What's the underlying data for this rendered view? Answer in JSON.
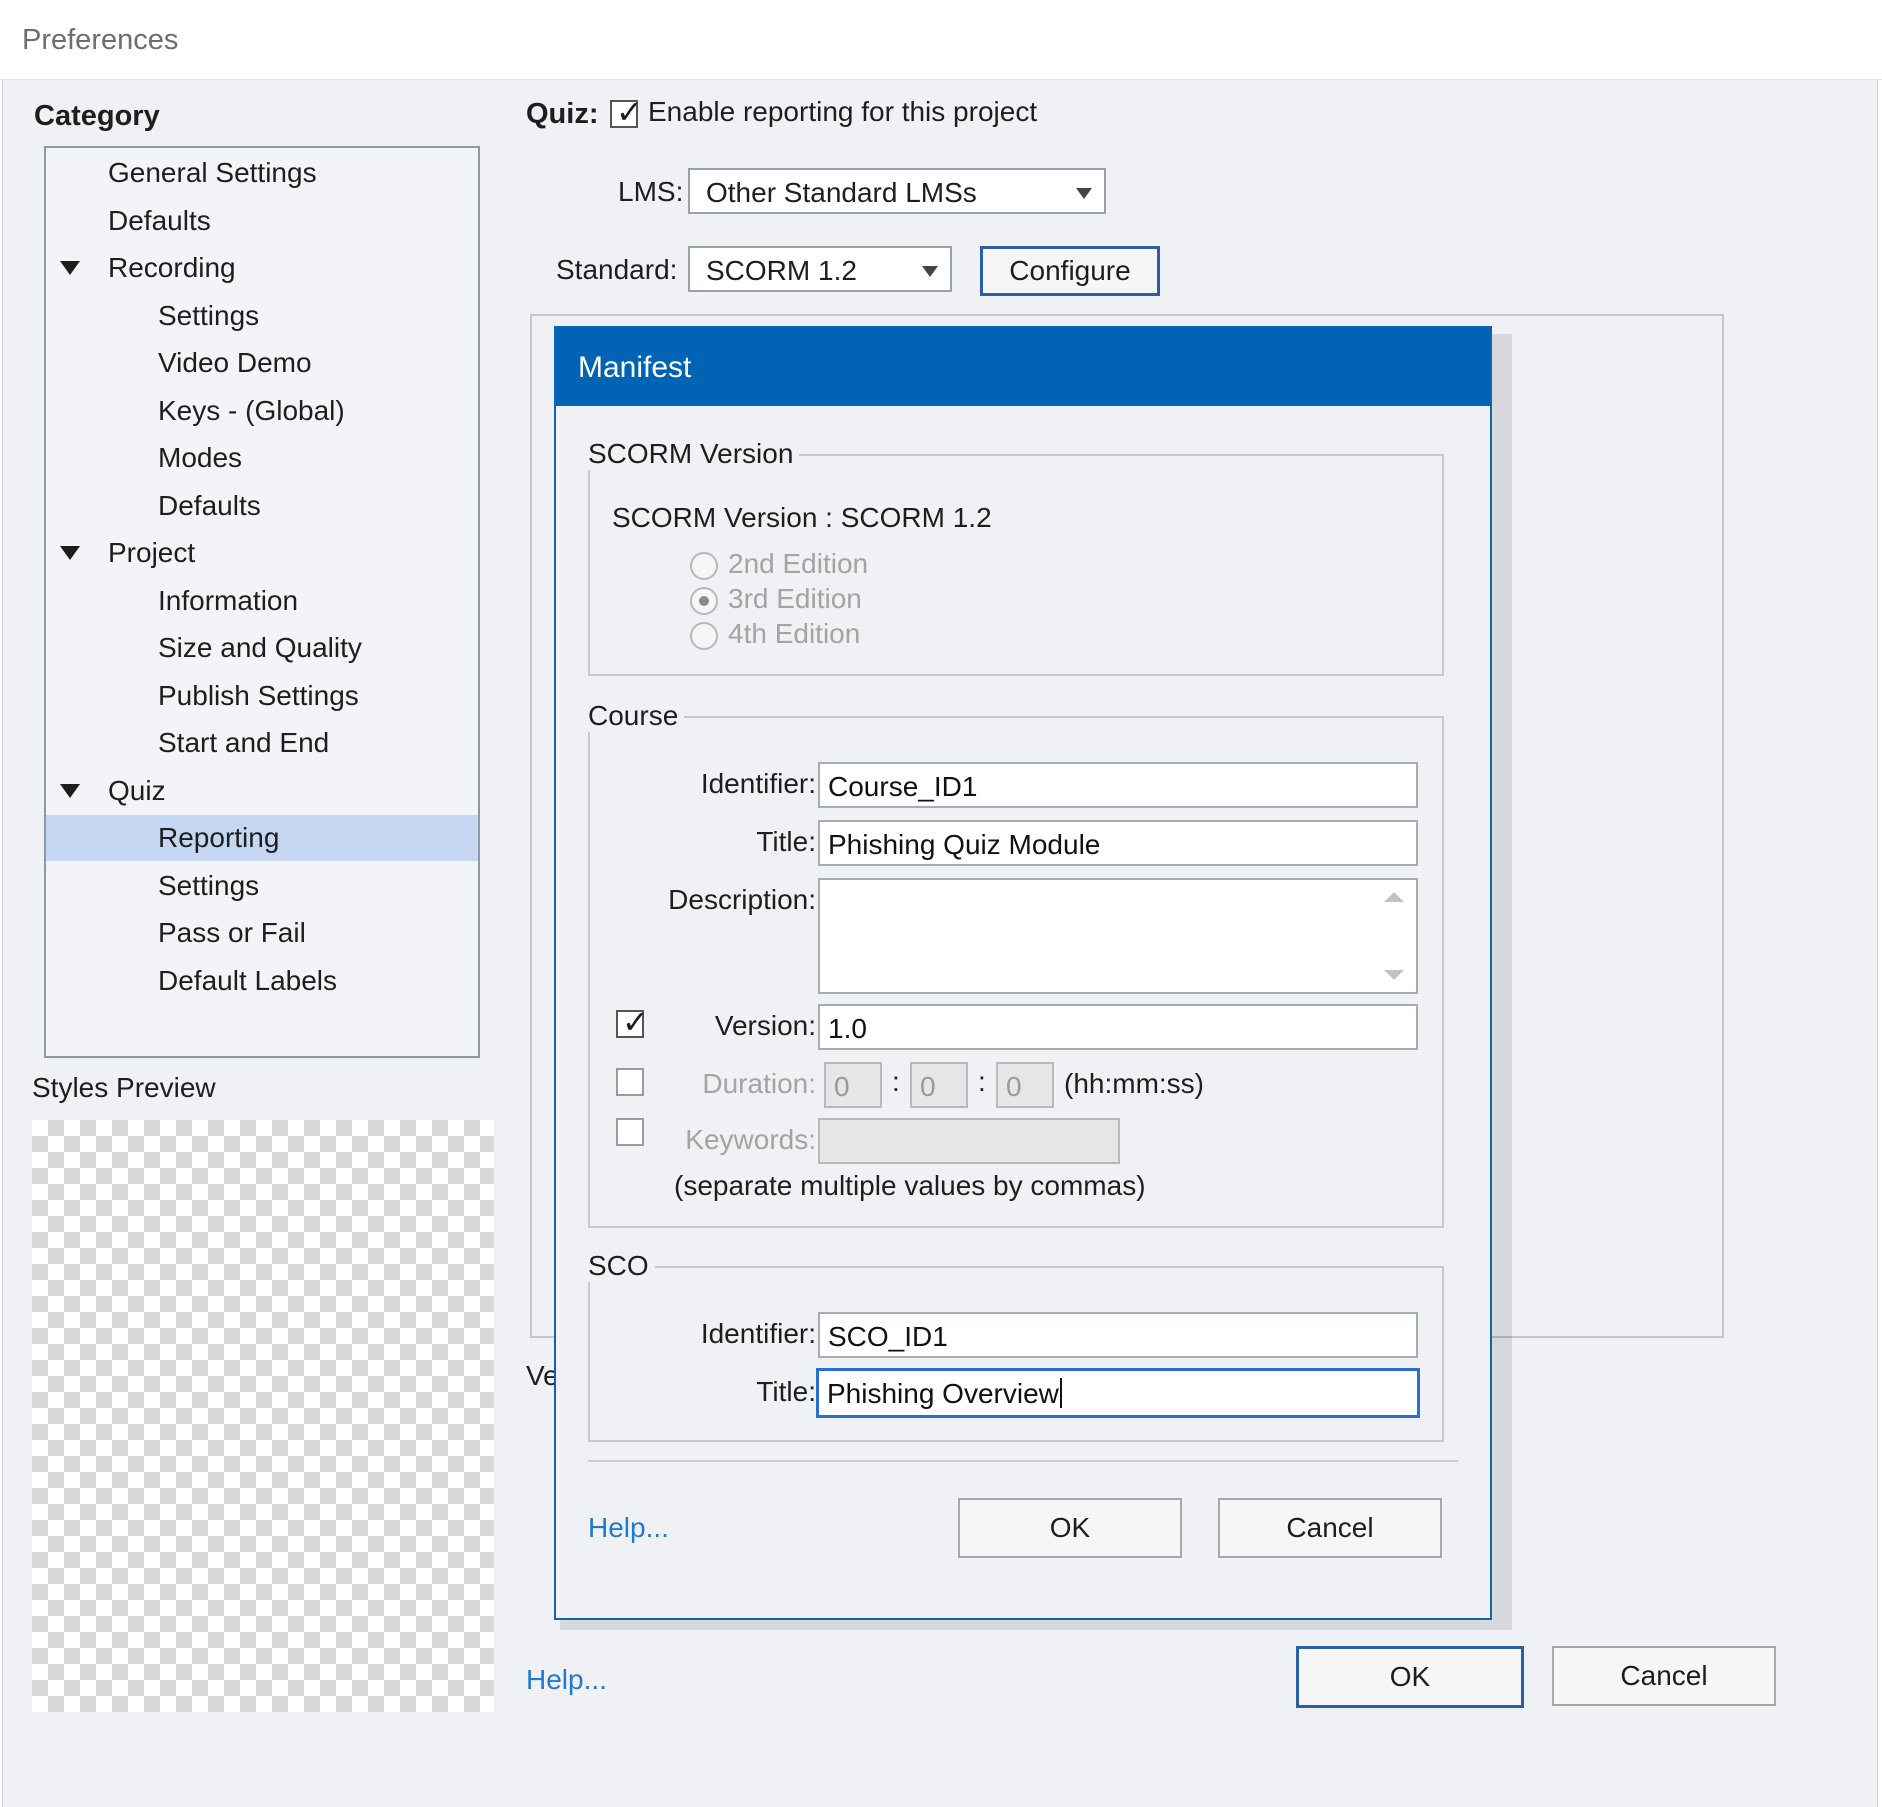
{
  "window": {
    "title": "Preferences"
  },
  "sidebar": {
    "category_label": "Category",
    "items": [
      {
        "label": "General Settings",
        "level": 0,
        "expander": false,
        "selected": false
      },
      {
        "label": "Defaults",
        "level": 0,
        "expander": false,
        "selected": false
      },
      {
        "label": "Recording",
        "level": 0,
        "expander": true,
        "selected": false
      },
      {
        "label": "Settings",
        "level": 1,
        "expander": false,
        "selected": false
      },
      {
        "label": "Video Demo",
        "level": 1,
        "expander": false,
        "selected": false
      },
      {
        "label": "Keys - (Global)",
        "level": 1,
        "expander": false,
        "selected": false
      },
      {
        "label": "Modes",
        "level": 1,
        "expander": false,
        "selected": false
      },
      {
        "label": "Defaults",
        "level": 1,
        "expander": false,
        "selected": false
      },
      {
        "label": "Project",
        "level": 0,
        "expander": true,
        "selected": false
      },
      {
        "label": "Information",
        "level": 1,
        "expander": false,
        "selected": false
      },
      {
        "label": "Size and Quality",
        "level": 1,
        "expander": false,
        "selected": false
      },
      {
        "label": "Publish Settings",
        "level": 1,
        "expander": false,
        "selected": false
      },
      {
        "label": "Start and End",
        "level": 1,
        "expander": false,
        "selected": false
      },
      {
        "label": "Quiz",
        "level": 0,
        "expander": true,
        "selected": false
      },
      {
        "label": "Reporting",
        "level": 1,
        "expander": false,
        "selected": true
      },
      {
        "label": "Settings",
        "level": 1,
        "expander": false,
        "selected": false
      },
      {
        "label": "Pass or Fail",
        "level": 1,
        "expander": false,
        "selected": false
      },
      {
        "label": "Default Labels",
        "level": 1,
        "expander": false,
        "selected": false
      }
    ],
    "styles_preview_label": "Styles Preview"
  },
  "main": {
    "quiz_label": "Quiz:",
    "enable_reporting": {
      "label": "Enable reporting for this project",
      "checked": true
    },
    "lms": {
      "label": "LMS:",
      "value": "Other Standard LMSs"
    },
    "standard": {
      "label": "Standard:",
      "value": "SCORM 1.2"
    },
    "configure_button": "Configure",
    "partial_label": "Ve",
    "help_link": "Help...",
    "ok_button": "OK",
    "cancel_button": "Cancel"
  },
  "manifest": {
    "title": "Manifest",
    "scorm_version_group": {
      "legend": "SCORM Version",
      "version_text": "SCORM Version : SCORM 1.2",
      "editions": [
        {
          "label": "2nd Edition",
          "selected": false
        },
        {
          "label": "3rd Edition",
          "selected": true
        },
        {
          "label": "4th Edition",
          "selected": false
        }
      ]
    },
    "course_group": {
      "legend": "Course",
      "identifier_label": "Identifier:",
      "identifier_value": "Course_ID1",
      "title_label": "Title:",
      "title_value": "Phishing Quiz Module",
      "description_label": "Description:",
      "description_value": "",
      "version_checked": true,
      "version_label": "Version:",
      "version_value": "1.0",
      "duration_checked": false,
      "duration_label": "Duration:",
      "duration_hh": "0",
      "duration_mm": "0",
      "duration_ss": "0",
      "duration_sep": ":",
      "duration_format": "(hh:mm:ss)",
      "keywords_checked": false,
      "keywords_label": "Keywords:",
      "keywords_value": "",
      "keywords_hint": "(separate multiple values by commas)"
    },
    "sco_group": {
      "legend": "SCO",
      "identifier_label": "Identifier:",
      "identifier_value": "SCO_ID1",
      "title_label": "Title:",
      "title_value": "Phishing Overview"
    },
    "help_link": "Help...",
    "ok_button": "OK",
    "cancel_button": "Cancel"
  },
  "colors": {
    "dialog_title_bar": "#0063b4",
    "selection": "#c4d6f2",
    "link": "#1f7bd1",
    "client_background": "#f0f1f5"
  }
}
